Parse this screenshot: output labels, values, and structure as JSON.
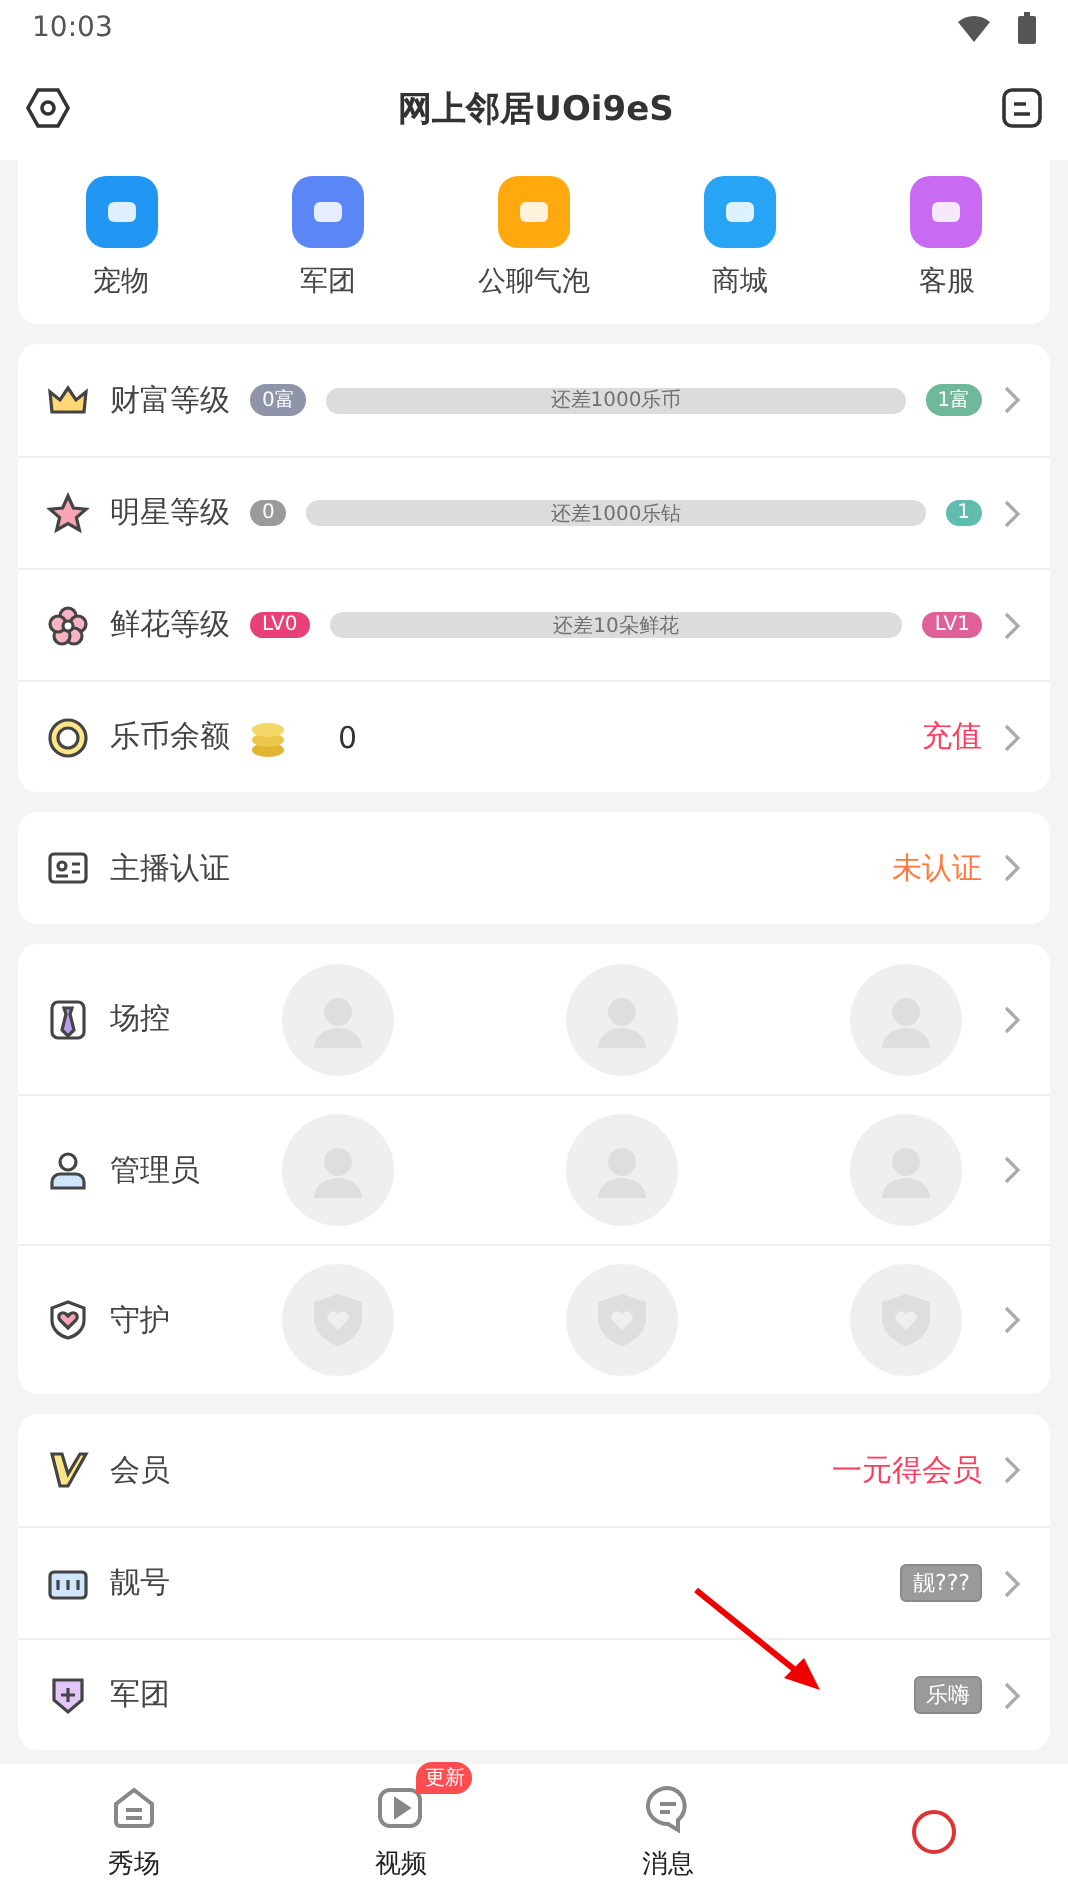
{
  "status_bar": {
    "time": "10:03"
  },
  "header": {
    "title": "网上邻居UOi9eS"
  },
  "shortcuts": [
    {
      "label": "宠物",
      "color": "#2196f3"
    },
    {
      "label": "军团",
      "color": "#5b86f5"
    },
    {
      "label": "公聊气泡",
      "color": "#ffa90f"
    },
    {
      "label": "商城",
      "color": "#27a4f5"
    },
    {
      "label": "客服",
      "color": "#c96bf2"
    }
  ],
  "levels": [
    {
      "kind": "wealth",
      "label": "财富等级",
      "from": "0富",
      "to": "1富",
      "hint": "还差1000乐币"
    },
    {
      "kind": "star",
      "label": "明星等级",
      "from": "0",
      "to": "1",
      "hint": "还差1000乐钻"
    },
    {
      "kind": "flower",
      "label": "鲜花等级",
      "from": "LV0",
      "to": "LV1",
      "hint": "还差10朵鲜花"
    }
  ],
  "balance": {
    "label": "乐币余额",
    "amount": "0",
    "action": "充值"
  },
  "verify": {
    "label": "主播认证",
    "status": "未认证"
  },
  "roles": [
    {
      "kind": "control",
      "label": "场控"
    },
    {
      "kind": "admin",
      "label": "管理员"
    },
    {
      "kind": "guard",
      "label": "守护"
    }
  ],
  "extras": [
    {
      "kind": "vip",
      "label": "会员",
      "value": "一元得会员"
    },
    {
      "kind": "number",
      "label": "靓号",
      "value": "靓???"
    },
    {
      "kind": "legion",
      "label": "军团",
      "value": "乐嗨"
    }
  ],
  "nav": [
    {
      "label": "秀场",
      "kind": "home"
    },
    {
      "label": "视频",
      "kind": "video",
      "badge": "更新"
    },
    {
      "label": "消息",
      "kind": "message"
    },
    {
      "kind": "profile"
    }
  ]
}
